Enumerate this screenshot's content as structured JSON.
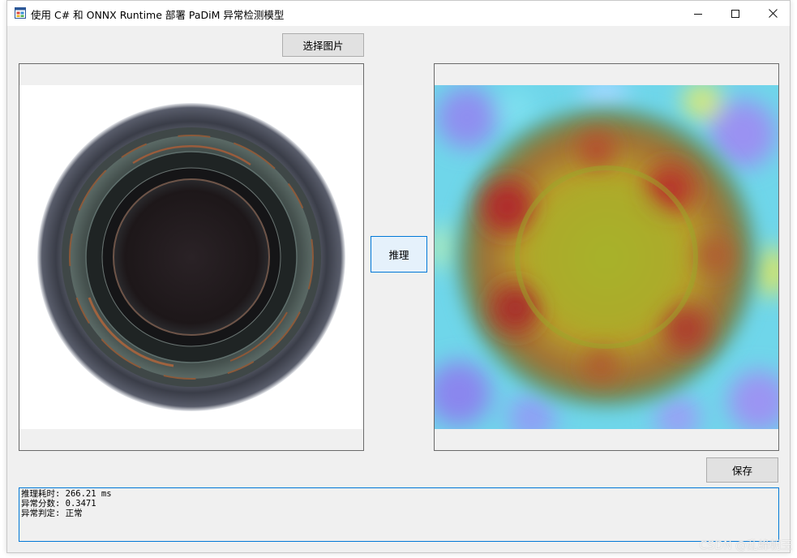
{
  "window": {
    "title": "使用 C# 和 ONNX Runtime 部署 PaDiM 异常检测模型",
    "minimize_icon": "minimize-icon",
    "maximize_icon": "maximize-icon",
    "close_icon": "close-icon"
  },
  "buttons": {
    "select_image": "选择图片",
    "infer": "推理",
    "save": "保存"
  },
  "output": {
    "lines": [
      "推理耗时: 266.21 ms",
      "异常分数: 0.3471",
      "异常判定: 正常"
    ]
  },
  "watermark": "CSDN @乱蜂朝王",
  "colors": {
    "accent": "#0078d7",
    "window_bg": "#f0f0f0",
    "button_bg": "#e1e1e1"
  }
}
